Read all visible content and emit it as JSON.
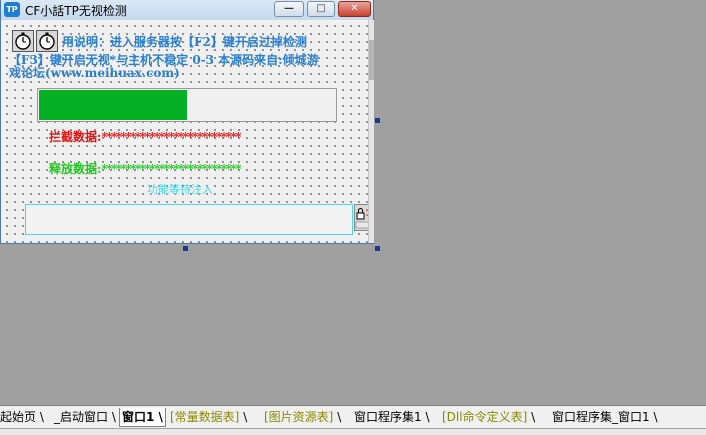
{
  "window": {
    "app_icon_text": "TP",
    "title": "CF小話TP无视检测",
    "min_glyph": "—",
    "max_glyph": "□",
    "close_glyph": "✕"
  },
  "form": {
    "instruction_line1": "用说明：进入服务器按【F2】键开启过掉检测",
    "instruction_line2": "【F3】键开启无视*与主机不稳定 0-3 本源码来自:倾城游",
    "instruction_line3": "戏论坛(www.meihuax.com)",
    "progress_percent": 50,
    "intercept_label": "拦截数据:",
    "intercept_value": "*****************************",
    "release_label": "释放数据:",
    "release_value": "*****************************",
    "status_text": "功能等待注入",
    "edit_value": ""
  },
  "tabs": [
    {
      "label": "起始页",
      "color": "#000000"
    },
    {
      "label": "_启动窗口",
      "color": "#000000"
    },
    {
      "label": "窗口1",
      "color": "#000000"
    },
    {
      "label": "[常量数据表]",
      "color": "#8a8a00"
    },
    {
      "label": "[图片资源表]",
      "color": "#8a8a00"
    },
    {
      "label": "窗口程序集1",
      "color": "#000000"
    },
    {
      "label": "[Dll命令定义表]",
      "color": "#8a8a00"
    },
    {
      "label": "窗口程序集_窗口1",
      "color": "#000000"
    }
  ],
  "colors": {
    "accent_text": "#2a7fd0",
    "intercept": "#e81010",
    "release": "#22c822",
    "progress": "#05b025"
  }
}
